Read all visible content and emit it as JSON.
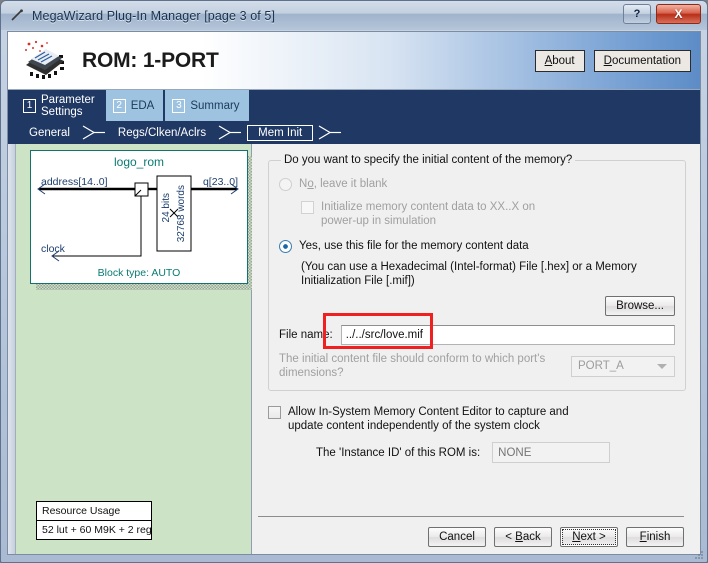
{
  "window": {
    "title": "MegaWizard Plug-In Manager [page 3 of 5]",
    "icon": "wand-icon",
    "help_label": "?",
    "close_label": "X"
  },
  "header": {
    "product_title": "ROM: 1-PORT",
    "logo": "altera-chip-logo",
    "about_label": "About",
    "about_accel": "A",
    "documentation_label": "Documentation",
    "documentation_accel": "D"
  },
  "tabs": [
    {
      "num": "1",
      "label": "Parameter\nSettings",
      "active": true
    },
    {
      "num": "2",
      "label": "EDA",
      "active": false
    },
    {
      "num": "3",
      "label": "Summary",
      "active": false
    }
  ],
  "subtabs": [
    {
      "label": "General",
      "selected": false
    },
    {
      "label": "Regs/Clken/Aclrs",
      "selected": false
    },
    {
      "label": "Mem Init",
      "selected": true
    }
  ],
  "diagram": {
    "module_name": "logo_rom",
    "input_port": "address[14..0]",
    "output_port": "q[23..0]",
    "clock_port": "clock",
    "mem_width": "24 bits",
    "mem_depth": "32768 words",
    "block_type": "Block type: AUTO"
  },
  "resource_usage": {
    "heading": "Resource Usage",
    "value": "52 lut + 60 M9K + 2 reg"
  },
  "settings": {
    "group_legend": "Do you want to specify the initial content of the memory?",
    "option_blank": "No, leave it blank",
    "option_blank_accel": "o",
    "option_blank_enabled": false,
    "checkbox_init_xx": "Initialize memory content data to XX..X on\npower-up in simulation",
    "checkbox_init_xx_checked": false,
    "option_file": "Yes, use this file for the memory content data",
    "option_file_selected": true,
    "file_hint": "(You can use a Hexadecimal (Intel-format) File [.hex] or a Memory\nInitialization File [.mif])",
    "browse_label": "Browse...",
    "filename_label": "File name:",
    "filename_value": "../../src/love.mif",
    "conform_text": "The initial content file should conform to which port's\ndimensions?",
    "port_value": "PORT_A",
    "insystem_label": "Allow In-System Memory Content Editor to capture and\nupdate content independently of the system clock",
    "insystem_checked": false,
    "instance_label": "The 'Instance ID' of this ROM is:",
    "instance_value": "NONE",
    "highlight_color": "#f02020"
  },
  "footer": {
    "cancel_label": "Cancel",
    "back_label": "< Back",
    "back_accel": "B",
    "next_label": "Next >",
    "next_accel": "N",
    "finish_label": "Finish",
    "finish_accel": "F"
  }
}
